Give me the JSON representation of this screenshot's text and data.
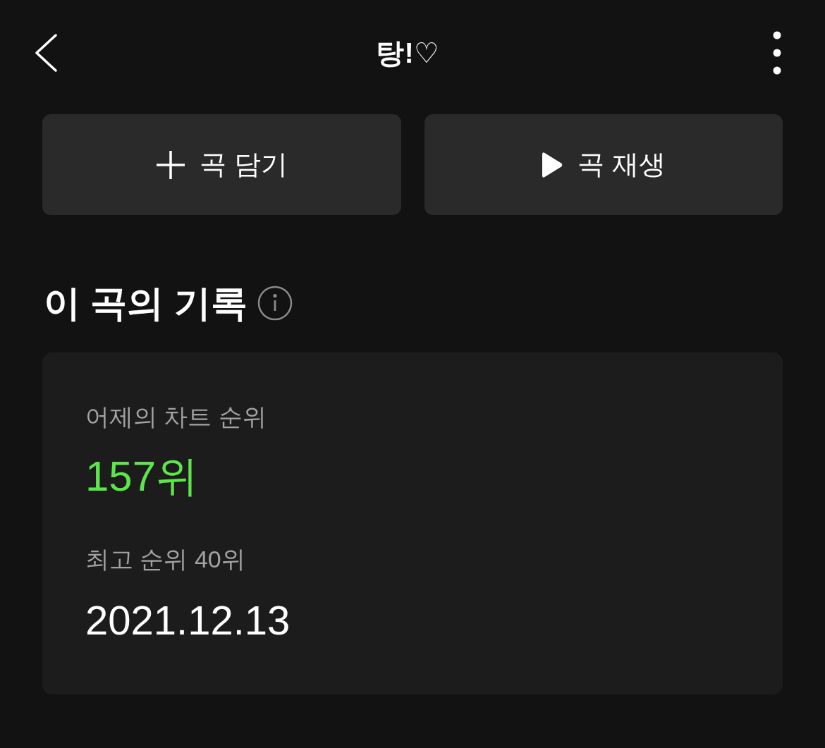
{
  "header": {
    "title": "탕!♡"
  },
  "actions": [
    {
      "kind": "add",
      "label": "곡 담기"
    },
    {
      "kind": "play",
      "label": "곡 재생"
    }
  ],
  "record": {
    "heading": "이 곡의 기록",
    "yesterday_label": "어제의 차트 순위",
    "yesterday_rank": "157위",
    "peak_label": "최고 순위 40위",
    "peak_date": "2021.12.13"
  }
}
